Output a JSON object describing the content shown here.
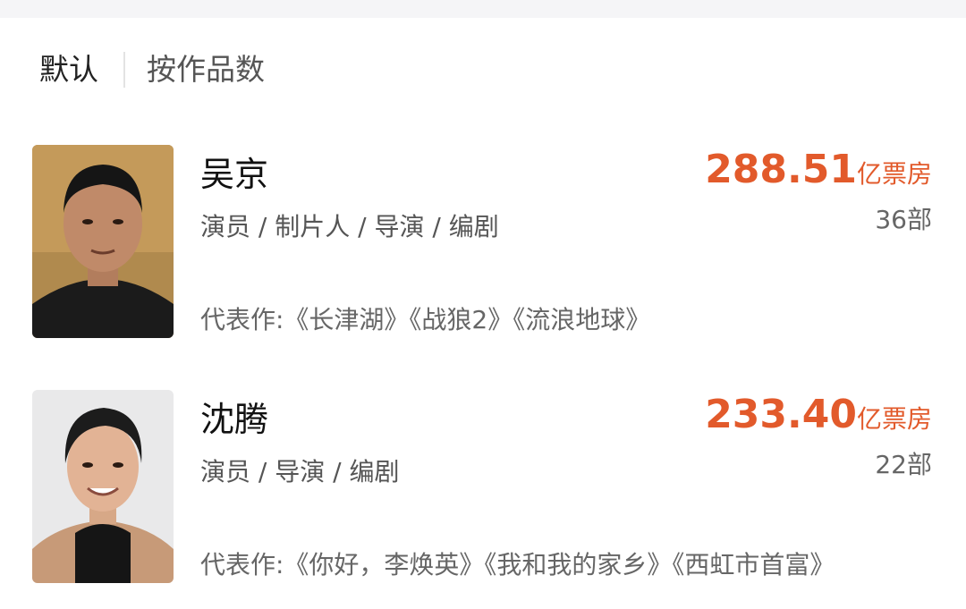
{
  "sort_tabs": {
    "default_label": "默认",
    "by_works_label": "按作品数"
  },
  "people": [
    {
      "name": "吴京",
      "roles": "演员 / 制片人 / 导演 / 编剧",
      "box_office_value": "288.51",
      "box_office_unit": "亿票房",
      "works_count": "36部",
      "representative_works": "代表作:《长津湖》《战狼2》《流浪地球》"
    },
    {
      "name": "沈腾",
      "roles": "演员 / 导演 / 编剧",
      "box_office_value": "233.40",
      "box_office_unit": "亿票房",
      "works_count": "22部",
      "representative_works": "代表作:《你好，李焕英》《我和我的家乡》《西虹市首富》"
    }
  ],
  "colors": {
    "accent": "#e25a2b",
    "text_primary": "#111111",
    "text_secondary": "#555555"
  }
}
